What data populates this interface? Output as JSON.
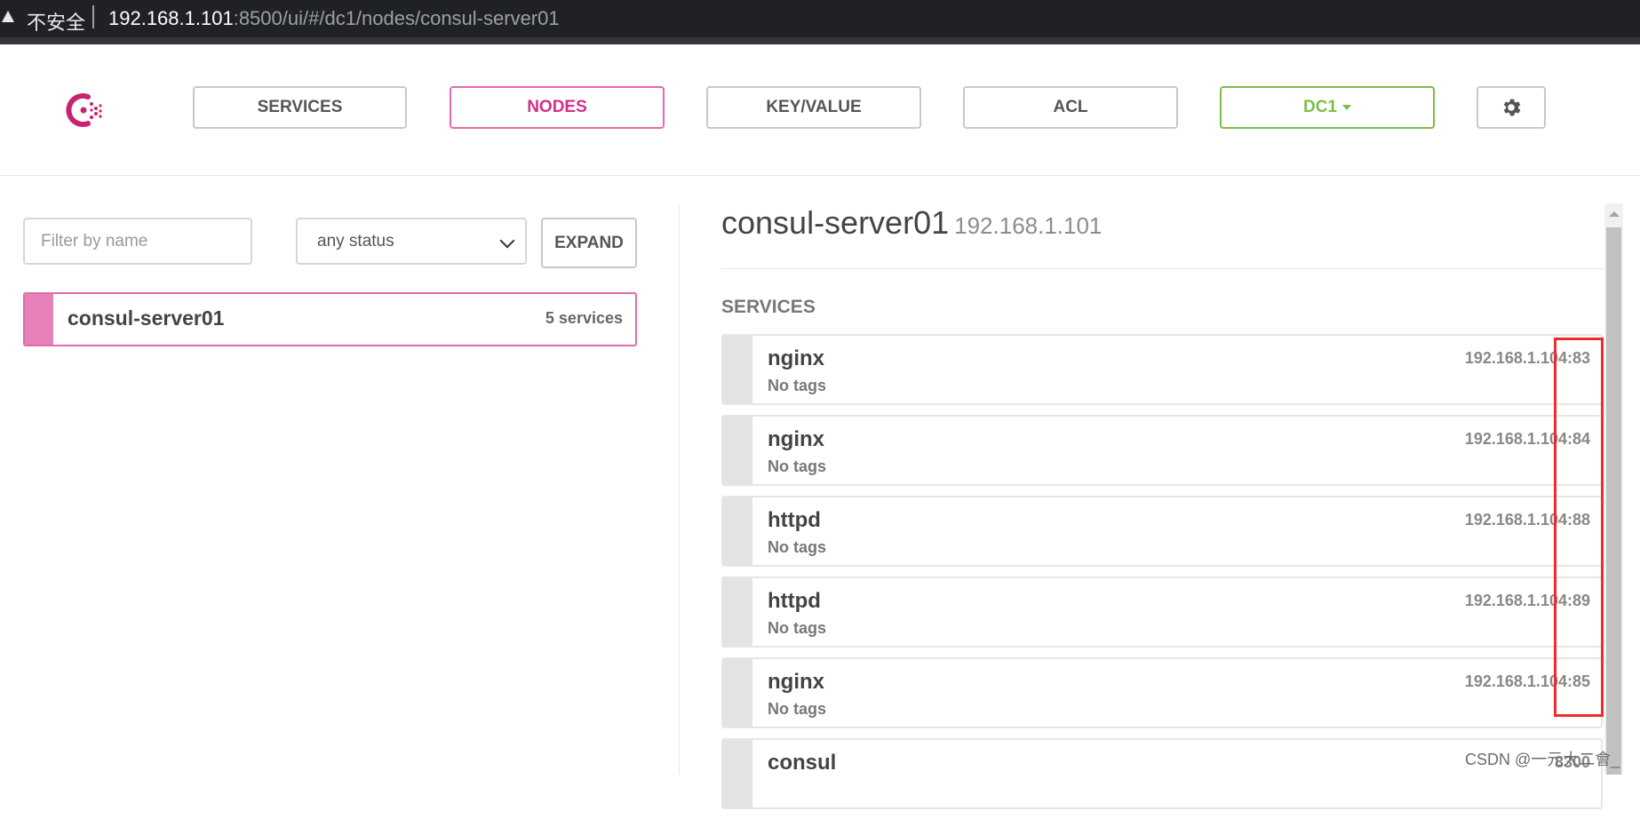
{
  "browser": {
    "security_label": "不安全",
    "url_host": "192.168.1.101",
    "url_rest": ":8500/ui/#/dc1/nodes/consul-server01"
  },
  "nav": {
    "services": "SERVICES",
    "nodes": "NODES",
    "keyvalue": "KEY/VALUE",
    "acl": "ACL",
    "datacenter": "DC1"
  },
  "colors": {
    "accent_pink": "#d62e86",
    "datacenter_green": "#7cbd4a",
    "annotation_red": "#ef2b2b"
  },
  "sidebar": {
    "filter_placeholder": "Filter by name",
    "status_selected": "any status",
    "expand_label": "EXPAND",
    "node": {
      "name": "consul-server01",
      "services_count": "5 services"
    }
  },
  "detail": {
    "node_name": "consul-server01",
    "node_ip": "192.168.1.101",
    "services_heading": "SERVICES",
    "services": [
      {
        "name": "nginx",
        "tags": "No tags",
        "address": "192.168.1.104:83"
      },
      {
        "name": "nginx",
        "tags": "No tags",
        "address": "192.168.1.104:84"
      },
      {
        "name": "httpd",
        "tags": "No tags",
        "address": "192.168.1.104:88"
      },
      {
        "name": "httpd",
        "tags": "No tags",
        "address": "192.168.1.104:89"
      },
      {
        "name": "nginx",
        "tags": "No tags",
        "address": "192.168.1.104:85"
      },
      {
        "name": "consul",
        "tags": "",
        "address": "8300"
      }
    ]
  },
  "watermark": "CSDN @一元大二會_"
}
